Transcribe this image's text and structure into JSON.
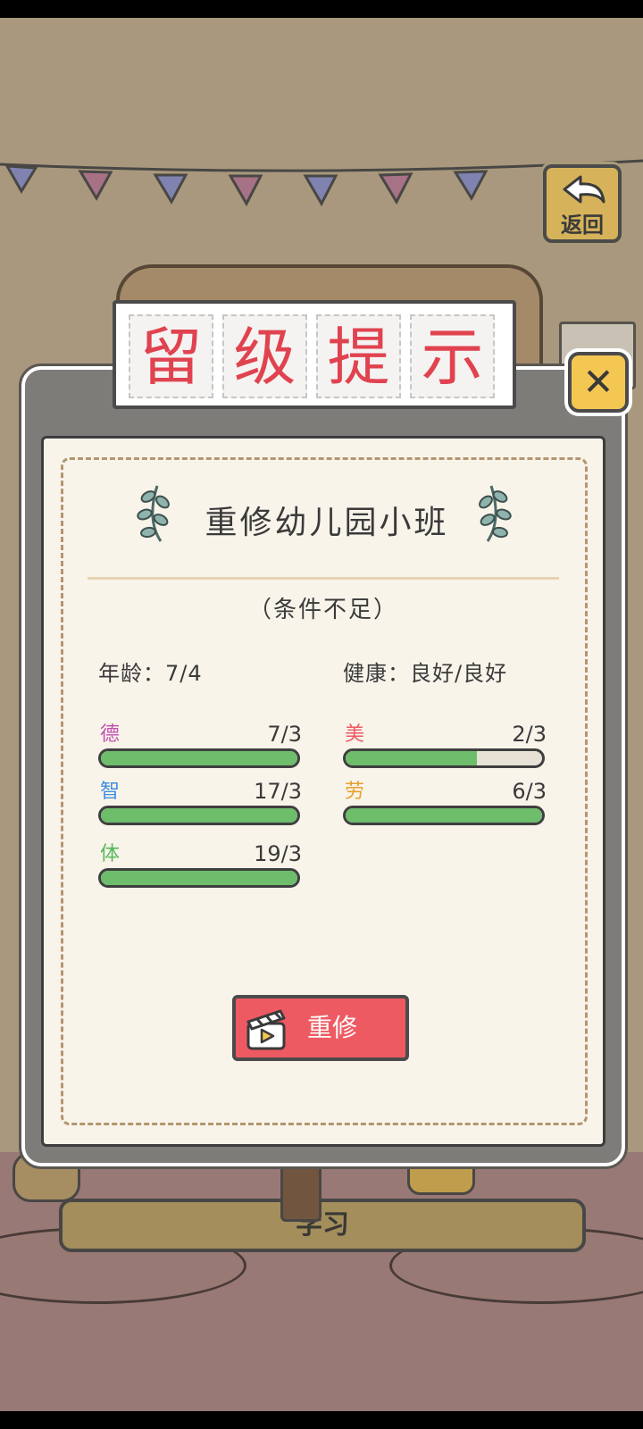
{
  "back_button": {
    "label": "返回",
    "icon": "back-arrow-icon"
  },
  "dialog": {
    "title_chars": [
      "留",
      "级",
      "提",
      "示"
    ],
    "subtitle": "重修幼儿园小班",
    "note": "（条件不足）",
    "age": "年龄：7/4",
    "health": "健康：良好/良好",
    "stats": [
      {
        "name": "德",
        "value": "7/3",
        "color": "#c34fb0",
        "fill_fraction": 1.0
      },
      {
        "name": "智",
        "value": "17/3",
        "color": "#3f8fe0",
        "fill_fraction": 1.0
      },
      {
        "name": "体",
        "value": "19/3",
        "color": "#56b85a",
        "fill_fraction": 1.0
      },
      {
        "name": "美",
        "value": "2/3",
        "color": "#ee5a62",
        "fill_fraction": 0.667
      },
      {
        "name": "劳",
        "value": "6/3",
        "color": "#e7a12e",
        "fill_fraction": 1.0
      }
    ],
    "retake_button": {
      "label": "重修",
      "icon": "clapperboard-icon"
    },
    "close_icon": "close-icon"
  },
  "bottom_bar": {
    "label": "学习"
  },
  "colors": {
    "title_red": "#e0434f",
    "button_red": "#ee5a62",
    "bar_green": "#6dbd6b",
    "close_yellow": "#f4c752"
  }
}
